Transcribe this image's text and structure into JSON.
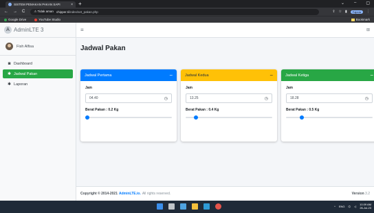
{
  "browser": {
    "tab_title": "SISTEM PEMAKAN PAKAN SAPI",
    "tab_close": "×",
    "new_tab": "+",
    "window_controls": [
      "⌄",
      "–",
      "▢"
    ],
    "nav": [
      "←",
      "→",
      "C"
    ],
    "url_warning": "⚠ Tidak aman",
    "url_host": "chipper.ti",
    "url_path": "/index/set_pakan.php",
    "profile": "Fajeda",
    "bookmarks": [
      {
        "label": "Google Drive",
        "color": "#34a853"
      },
      {
        "label": "YouTube Studio",
        "color": "#ea4335"
      }
    ],
    "bookmark_folder": "Bookmark"
  },
  "sidebar": {
    "brand_letter": "A",
    "brand": "AdminLTE 3",
    "user": "Fish Alfisa",
    "items": [
      {
        "icon": "◙",
        "label": "Dashboard"
      },
      {
        "icon": "✱",
        "label": "Jadwal Pakan"
      },
      {
        "icon": "✱",
        "label": "Laporan"
      }
    ]
  },
  "navbar": {
    "menu_icon": "≡",
    "expand_icon": "⊞"
  },
  "page": {
    "title": "Jadwal Pakan"
  },
  "cards": [
    {
      "title": "Jadwal Pertama",
      "minus": "−",
      "color": "#007bff",
      "text_color": "#ffffff",
      "jam_label": "Jam",
      "time": "04.40",
      "berat_label": "Berat Pakan : 0.2 Kg",
      "level": 0.02
    },
    {
      "title": "Jadwal Kedua",
      "minus": "−",
      "color": "#ffc107",
      "text_color": "#1f2d3d",
      "jam_label": "Jam",
      "time": "13.25",
      "berat_label": "Berat Pakan : 0.4 Kg",
      "level": 0.12
    },
    {
      "title": "Jadwal Ketiga",
      "minus": "−",
      "color": "#28a745",
      "text_color": "#ffffff",
      "jam_label": "Jam",
      "time": "18.28",
      "berat_label": "Berat Pakan : 0.5 Kg",
      "level": 0.18
    }
  ],
  "footer": {
    "copyright": "Copyright © 2014-2021",
    "link": "AdminLTE.io.",
    "rest": "All rights reserved.",
    "version_label": "Version",
    "version": "3.2"
  },
  "taskbar": {
    "icons": [
      {
        "name": "windows-start-icon",
        "color": "#3b8eea"
      },
      {
        "name": "task-view-icon",
        "color": "#c0c4c8"
      },
      {
        "name": "store-icon",
        "color": "#4fa3e0"
      },
      {
        "name": "file-explorer-icon",
        "color": "#f3c03c"
      },
      {
        "name": "edge-icon",
        "color": "#2e9bd6"
      },
      {
        "name": "chrome-icon",
        "color": "#e5544b"
      }
    ],
    "tray_up": "^",
    "language": "ENG",
    "time": "10.09 AM",
    "date": "26-Jul-23"
  }
}
